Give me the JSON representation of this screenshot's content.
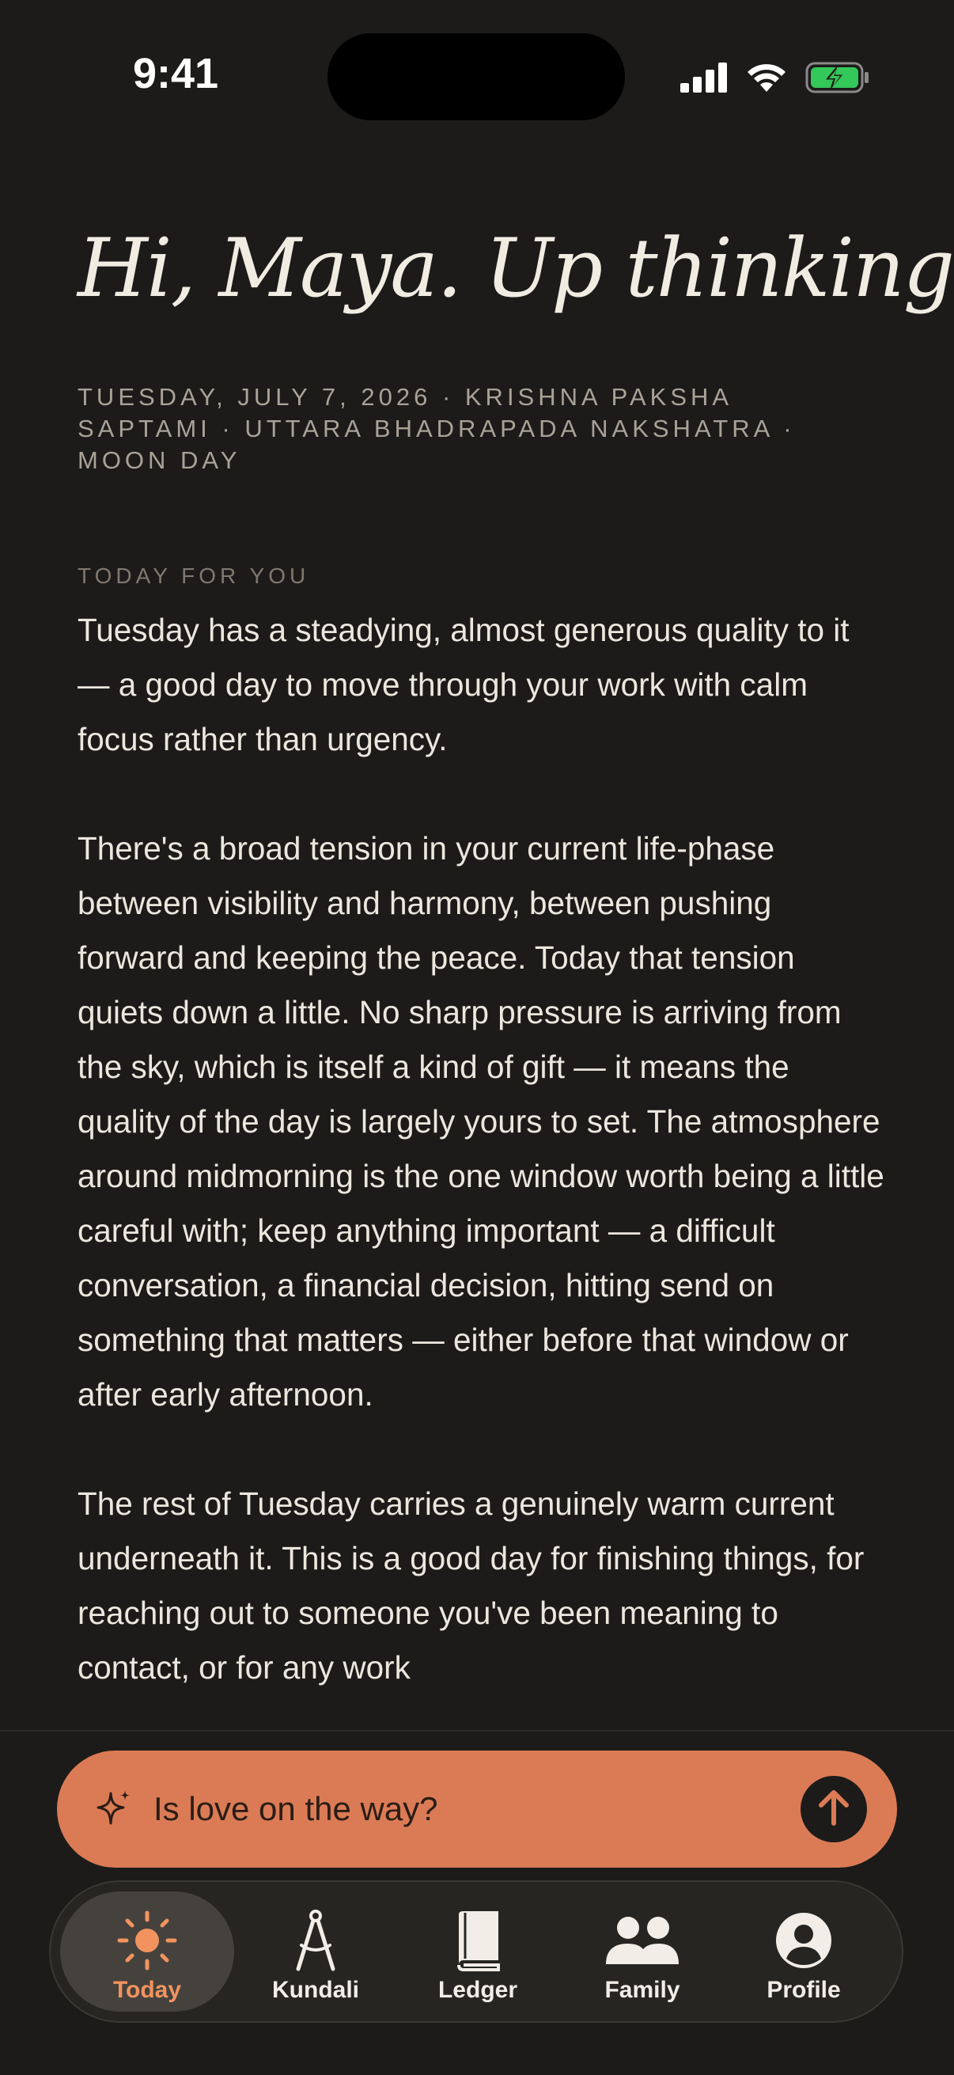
{
  "status_bar": {
    "time": "9:41"
  },
  "header": {
    "greeting": "Hi, Maya. Up thinking?",
    "date_line": "Tuesday, July 7, 2026 · Krishna Paksha Saptami · Uttara Bhadrapada Nakshatra · Moon Day"
  },
  "reading": {
    "section_label": "Today for you",
    "paragraphs": [
      "Tuesday has a steadying, almost generous quality to it — a good day to move through your work with calm focus rather than urgency.",
      "There's a broad tension in your current life-phase between visibility and harmony, between pushing forward and keeping the peace. Today that tension quiets down a little. No sharp pressure is arriving from the sky, which is itself a kind of gift — it means the quality of the day is largely yours to set. The atmosphere around midmorning is the one window worth being a little careful with; keep anything important — a difficult conversation, a financial decision, hitting send on something that matters — either before that window or after early afternoon.",
      "The rest of Tuesday carries a genuinely warm current underneath it. This is a good day for finishing things, for reaching out to someone you've been meaning to contact, or for any work"
    ]
  },
  "ask": {
    "text": "Is love on the way?",
    "icon": "sparkle-icon",
    "send_icon": "arrow-up-icon"
  },
  "tabs": [
    {
      "label": "Today",
      "icon": "sun-icon",
      "active": true
    },
    {
      "label": "Kundali",
      "icon": "compass-icon",
      "active": false
    },
    {
      "label": "Ledger",
      "icon": "book-icon",
      "active": false
    },
    {
      "label": "Family",
      "icon": "people-icon",
      "active": false
    },
    {
      "label": "Profile",
      "icon": "person-circle-icon",
      "active": false
    }
  ],
  "colors": {
    "background": "#1c1b19",
    "accent": "#db7b55",
    "active_tab_label": "#f2935f",
    "battery_fill": "#34c759"
  }
}
